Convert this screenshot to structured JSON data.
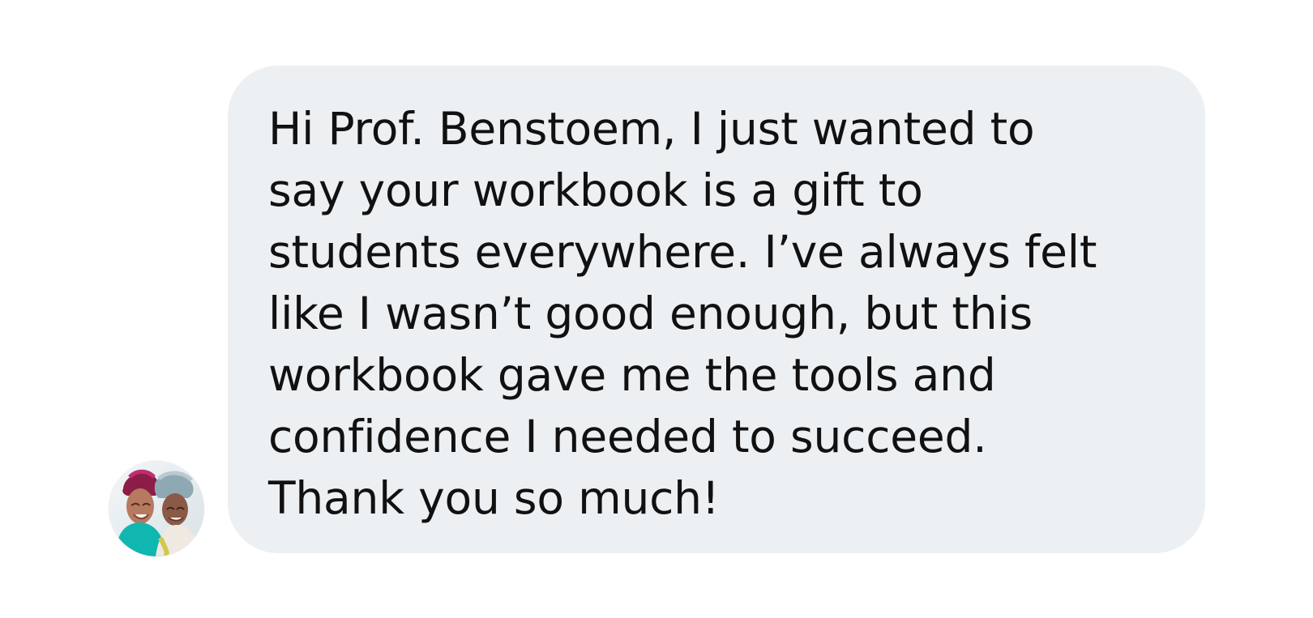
{
  "message": {
    "text": "Hi Prof. Benstoem, I just wanted to\nsay your workbook is a gift to\nstudents everywhere. I’ve always felt\nlike I wasn’t good enough, but this\nworkbook gave me the tools and\nconfidence I needed to succeed.\nThank you so much!",
    "bubble_color": "#ecf0f3",
    "text_color": "#111111"
  },
  "sender": {
    "avatar_icon": "two-women-photo-avatar"
  }
}
